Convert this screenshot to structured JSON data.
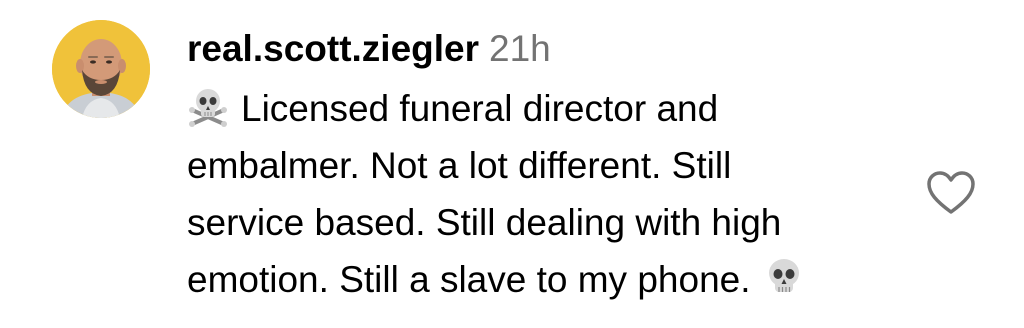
{
  "comment": {
    "username": "real.scott.ziegler",
    "timestamp": "21h",
    "lines": [
      "Licensed funeral director and",
      "embalmer. Not a lot different. Still",
      "service based. Still dealing with high",
      "emotion. Still a slave to my phone."
    ],
    "leading_emoji": "skull-and-crossbones-icon",
    "trailing_emoji": "skull-icon",
    "avatar_background": "#f0c23a"
  },
  "actions": {
    "like_icon": "heart-outline-icon"
  },
  "colors": {
    "text": "#000000",
    "timestamp": "#737373",
    "like_outline": "#737373"
  }
}
